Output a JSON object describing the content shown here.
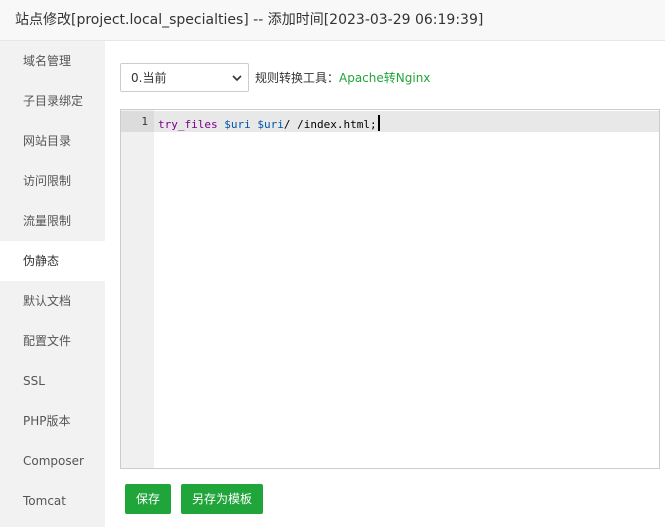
{
  "window": {
    "title": "站点修改[project.local_specialties] -- 添加时间[2023-03-29 06:19:39]"
  },
  "sidebar": {
    "active_index": 5,
    "items": [
      {
        "label": "域名管理"
      },
      {
        "label": "子目录绑定"
      },
      {
        "label": "网站目录"
      },
      {
        "label": "访问限制"
      },
      {
        "label": "流量限制"
      },
      {
        "label": "伪静态"
      },
      {
        "label": "默认文档"
      },
      {
        "label": "配置文件"
      },
      {
        "label": "SSL"
      },
      {
        "label": "PHP版本"
      },
      {
        "label": "Composer"
      },
      {
        "label": "Tomcat"
      }
    ]
  },
  "rewrite": {
    "template_select": {
      "selected": "0.当前"
    },
    "tool_label": "规则转换工具：",
    "tool_link": "Apache转Nginx",
    "editor": {
      "line_number": "1",
      "code": {
        "keyword": "try_files",
        "var1": "$uri",
        "var2": "$uri",
        "rest": "/ /index.html;"
      }
    },
    "buttons": {
      "save": "保存",
      "save_as_template": "另存为模板"
    }
  },
  "colors": {
    "accent": "#20a53a",
    "sidebar_bg": "#f2f2f2",
    "keyword": "#770088",
    "variable": "#0055aa"
  },
  "icons": {
    "select_chevron": "chevron-down-icon"
  }
}
